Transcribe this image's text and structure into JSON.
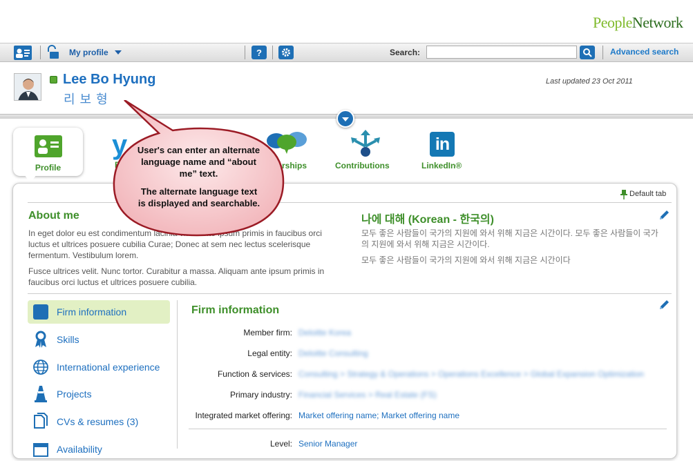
{
  "brand": {
    "part1": "People",
    "part2": "Network"
  },
  "toolbar": {
    "my_profile": "My profile",
    "help_icon_label": "?",
    "search_label": "Search:",
    "search_placeholder": "",
    "advanced_search": "Advanced search"
  },
  "profile": {
    "name": "Lee Bo Hyung",
    "name_alt": "리보형",
    "last_updated": "Last updated 23 Oct 2011"
  },
  "tabs": [
    {
      "label": "Profile"
    },
    {
      "label": "B"
    },
    {
      "label": "berships"
    },
    {
      "label": "Contributions"
    },
    {
      "label": "LinkedIn®"
    }
  ],
  "callout": {
    "line1": "User's can enter an alternate language name and “about me” text.",
    "line2": "The alternate language text is displayed and searchable."
  },
  "panel": {
    "default_tab": "Default tab",
    "about_title": "About me",
    "about_p1": "In eget dolor eu est condimentum lacinia vitae ante ipsum primis in faucibus orci luctus et ultrices posuere cubilia Curae; Donec at sem nec lectus scelerisque fermentum. Vestibulum lorem.",
    "about_p2": "Fusce ultrices velit. Nunc tortor. Curabitur a massa. Aliquam ante ipsum primis in faucibus orci luctus et ultrices posuere cubilia.",
    "korean_title": "나에 대해 (Korean - 한국의)",
    "korean_p1": "모두 좋은 사람들이 국가의 지원에 와서 위해 지금은 시간이다. 모두 좋은 사람들이 국가의 지원에 와서 위해 지금은 시간이다.",
    "korean_p2": "모두 좋은 사람들이 국가의 지원에 와서 위해 지금은 시간이다"
  },
  "nav": [
    {
      "label": "Firm information"
    },
    {
      "label": "Skills"
    },
    {
      "label": "International experience"
    },
    {
      "label": "Projects"
    },
    {
      "label": "CVs & resumes (3)"
    },
    {
      "label": "Availability"
    }
  ],
  "firm": {
    "title": "Firm information",
    "rows": [
      {
        "label": "Member firm:",
        "value": "Deloitte Korea"
      },
      {
        "label": "Legal entity:",
        "value": "Deloitte Consulting"
      },
      {
        "label": "Function & services:",
        "value": "Consulting > Strategy & Operations > Operations Excellence > Global Expansion Optimization"
      },
      {
        "label": "Primary industry:",
        "value": "Financial Services > Real Estate (FS)"
      },
      {
        "label": "Integrated market offering:",
        "value": "Market offering name; Market offering name"
      },
      {
        "label": "Level:",
        "value": "Senior Manager"
      }
    ]
  }
}
